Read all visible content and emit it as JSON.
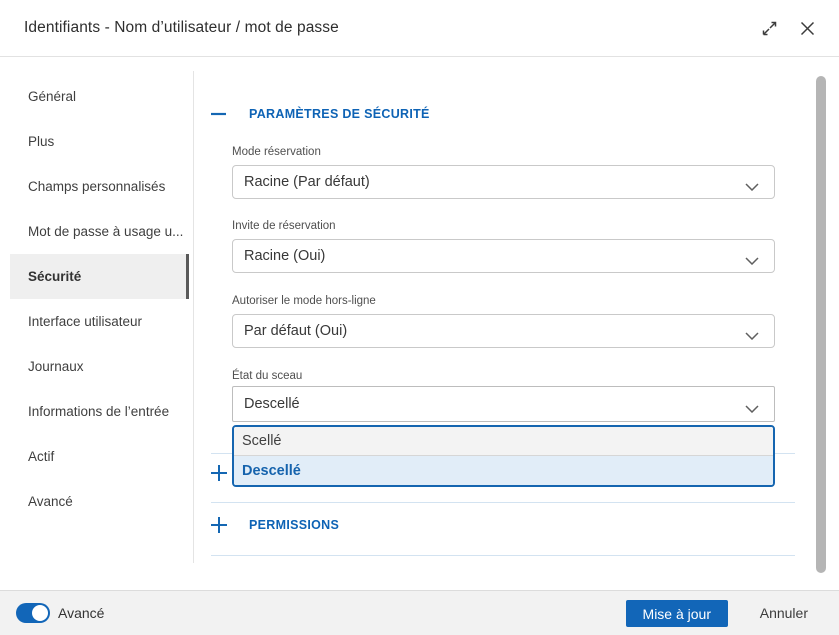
{
  "dialog": {
    "title": "Identifiants - Nom d’utilisateur / mot de passe"
  },
  "sidebar": {
    "items": [
      {
        "label": "Général",
        "selected": false
      },
      {
        "label": "Plus",
        "selected": false
      },
      {
        "label": "Champs personnalisés",
        "selected": false
      },
      {
        "label": "Mot de passe à usage u...",
        "selected": false
      },
      {
        "label": "Sécurité",
        "selected": true
      },
      {
        "label": "Interface utilisateur",
        "selected": false
      },
      {
        "label": "Journaux",
        "selected": false
      },
      {
        "label": "Informations de l’entrée",
        "selected": false
      },
      {
        "label": "Actif",
        "selected": false
      },
      {
        "label": "Avancé",
        "selected": false
      }
    ]
  },
  "content": {
    "security_section": {
      "title": "PARAMÈTRES DE SÉCURITÉ",
      "state": "expanded"
    },
    "fields": [
      {
        "label": "Mode réservation",
        "value": "Racine (Par défaut)"
      },
      {
        "label": "Invite de réservation",
        "value": "Racine (Oui)"
      },
      {
        "label": "Autoriser le mode hors-ligne",
        "value": "Par défaut (Oui)"
      },
      {
        "label": "État du sceau",
        "value": "Descellé"
      }
    ],
    "seal_dropdown": {
      "options": [
        {
          "label": "Scellé",
          "selected": false
        },
        {
          "label": "Descellé",
          "selected": true
        }
      ]
    },
    "collapsed_section": {
      "state": "collapsed"
    },
    "permissions_section": {
      "title": "PERMISSIONS",
      "state": "collapsed"
    }
  },
  "footer": {
    "advanced_toggle": {
      "label": "Avancé",
      "on": true
    },
    "update_button": "Mise à jour",
    "cancel_button": "Annuler"
  },
  "colors": {
    "accent_blue": "#1266b8",
    "section_title_blue": "#0e63b5",
    "dropdown_border": "#1565b0",
    "selected_option_bg": "#e1edf8",
    "selected_option_text": "#1563ad",
    "content_divider": "#d3e3f1",
    "footer_bg": "#f2f2f2"
  }
}
